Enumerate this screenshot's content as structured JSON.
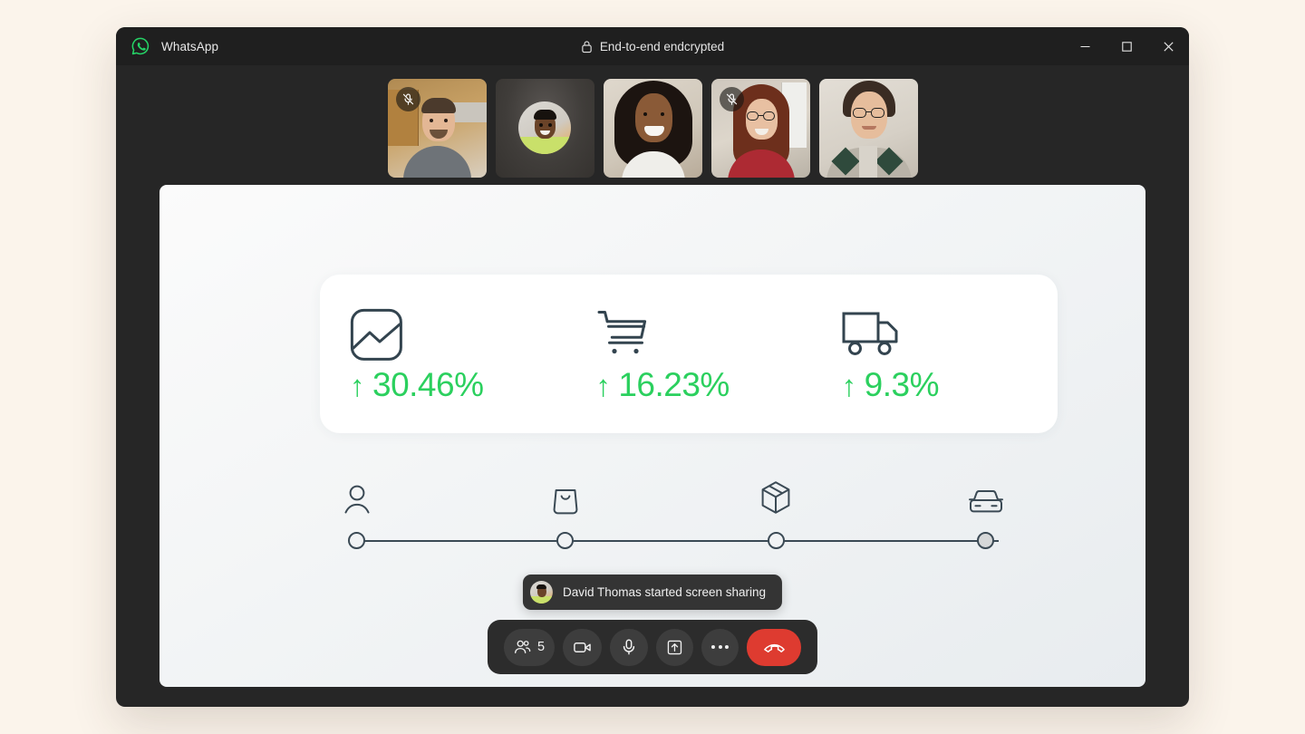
{
  "window": {
    "app_name": "WhatsApp",
    "app_logo_icon": "whatsapp-logo-icon",
    "encryption_label": "End-to-end endcrypted",
    "lock_icon": "lock-icon",
    "controls": {
      "minimize": "minimize-icon",
      "maximize": "maximize-icon",
      "close": "close-icon"
    }
  },
  "participants": [
    {
      "id": "p1",
      "camera_on": true,
      "muted": true,
      "mute_icon": "mic-off-icon"
    },
    {
      "id": "p2",
      "camera_on": false,
      "muted": false,
      "avatar": "avatar-david-thomas"
    },
    {
      "id": "p3",
      "camera_on": true,
      "muted": false
    },
    {
      "id": "p4",
      "camera_on": true,
      "muted": true,
      "mute_icon": "mic-off-icon"
    },
    {
      "id": "p5",
      "camera_on": true,
      "muted": false
    }
  ],
  "shared_screen": {
    "stats_card": {
      "accent_color": "#2BD05E",
      "icon_color": "#33444F",
      "stats": [
        {
          "icon": "chart-image-icon",
          "arrow": "↑",
          "value": "30.46%"
        },
        {
          "icon": "shopping-cart-icon",
          "arrow": "↑",
          "value": "16.23%"
        },
        {
          "icon": "delivery-truck-icon",
          "arrow": "↑",
          "value": "9.3%"
        }
      ]
    },
    "stepper": {
      "line_color": "#3B4A55",
      "steps": [
        {
          "icon": "person-icon",
          "state": "empty"
        },
        {
          "icon": "shopping-bag-icon",
          "state": "empty"
        },
        {
          "icon": "package-box-icon",
          "state": "empty"
        },
        {
          "icon": "car-icon",
          "state": "filled"
        }
      ]
    }
  },
  "toast": {
    "avatar": "avatar-david-thomas",
    "message": "David Thomas started screen sharing"
  },
  "call_controls": {
    "participants": {
      "icon": "people-icon",
      "count": "5"
    },
    "camera": {
      "icon": "video-camera-icon"
    },
    "microphone": {
      "icon": "microphone-icon"
    },
    "share_screen": {
      "icon": "share-screen-icon"
    },
    "more": {
      "icon": "more-dots-icon"
    },
    "end_call": {
      "icon": "end-call-icon",
      "color": "#DE3B30"
    }
  }
}
